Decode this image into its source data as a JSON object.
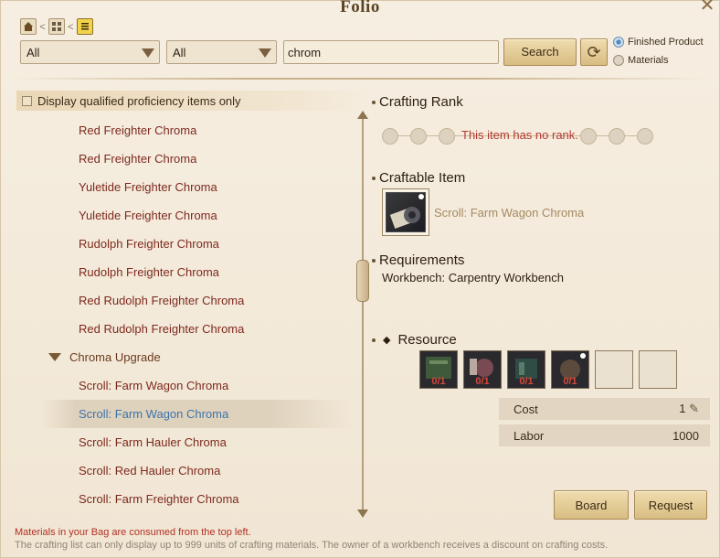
{
  "window": {
    "title": "Folio"
  },
  "filters": {
    "category1": "All",
    "category2": "All",
    "search_value": "chrom",
    "search_label": "Search",
    "radio_finished": "Finished Product",
    "radio_materials": "Materials"
  },
  "left": {
    "qualified_label": "Display qualified proficiency items only",
    "items": [
      {
        "label": "Red Freighter Chroma"
      },
      {
        "label": "Red Freighter Chroma"
      },
      {
        "label": "Yuletide Freighter Chroma"
      },
      {
        "label": "Yuletide Freighter Chroma"
      },
      {
        "label": "Rudolph Freighter Chroma"
      },
      {
        "label": "Rudolph Freighter Chroma"
      },
      {
        "label": "Red Rudolph Freighter Chroma"
      },
      {
        "label": "Red Rudolph Freighter Chroma"
      }
    ],
    "group": "Chroma Upgrade",
    "group_items": [
      {
        "label": "Scroll: Farm Wagon Chroma"
      },
      {
        "label": "Scroll: Farm Wagon Chroma"
      },
      {
        "label": "Scroll: Farm Hauler Chroma"
      },
      {
        "label": "Scroll: Red Hauler Chroma"
      },
      {
        "label": "Scroll: Farm Freighter Chroma"
      }
    ]
  },
  "right": {
    "rank_title": "Crafting Rank",
    "rank_message": "This item has no rank.",
    "craftable_title": "Craftable Item",
    "craftable_name": "Scroll: Farm Wagon Chroma",
    "requirements_title": "Requirements",
    "requirements_text": "Workbench: Carpentry Workbench",
    "resource_title": "Resource",
    "resources": [
      {
        "count": "0/1"
      },
      {
        "count": "0/1"
      },
      {
        "count": "0/1"
      },
      {
        "count": "0/1"
      }
    ],
    "cost_label": "Cost",
    "cost_value": "1",
    "labor_label": "Labor",
    "labor_value": "1000"
  },
  "actions": {
    "board": "Board",
    "request": "Request"
  },
  "footer": {
    "warning": "Materials in your Bag are consumed from the top left.",
    "info": "The crafting list can only display up to 999 units of crafting materials. The owner of a workbench receives a discount on crafting costs."
  },
  "colors": {
    "accent_text": "#7d2a1e",
    "selected_text": "#3e73a8",
    "warning": "#b12f25"
  },
  "icons": [
    "home-icon",
    "grid-icon",
    "list-icon",
    "refresh-icon",
    "close-icon",
    "pen-icon"
  ]
}
